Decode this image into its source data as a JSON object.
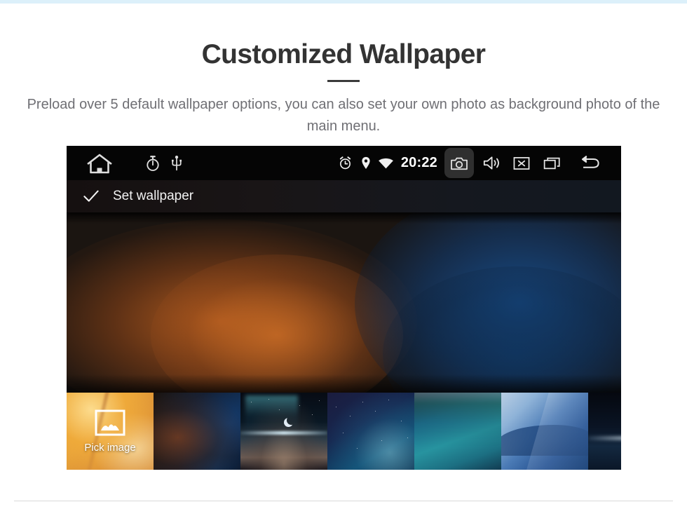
{
  "header": {
    "title": "Customized Wallpaper",
    "subtitle": "Preload over 5 default wallpaper options, you can also set your own photo as background photo of the main menu.",
    "accent_color": "#dcf0fa",
    "title_color": "#333333",
    "subtitle_color": "#6f6f74"
  },
  "device": {
    "statusbar": {
      "background": "#050505",
      "clock": "20:22",
      "left_icons": [
        {
          "name": "home-icon",
          "label": "Home"
        },
        {
          "name": "timer-icon",
          "label": "Timer"
        },
        {
          "name": "usb-icon",
          "label": "USB"
        }
      ],
      "right_icons": [
        {
          "name": "alarm-icon",
          "label": "Alarm"
        },
        {
          "name": "location-pin-icon",
          "label": "Location"
        },
        {
          "name": "wifi-icon",
          "label": "Wi-Fi"
        },
        {
          "name": "camera-icon",
          "label": "Screenshot",
          "highlighted": true
        },
        {
          "name": "volume-icon",
          "label": "Volume"
        },
        {
          "name": "close-icon",
          "label": "Close"
        },
        {
          "name": "recents-icon",
          "label": "Recent apps"
        },
        {
          "name": "back-icon",
          "label": "Back"
        }
      ]
    },
    "actionbar": {
      "confirm_icon": "check-icon",
      "label": "Set wallpaper"
    },
    "preview": {
      "name": "wallpaper-preview",
      "description": "Blurred gradient wallpaper with warm orange glow at left and deep blue glow at right",
      "warm_color": "#ba6020",
      "cool_color": "#184e8c"
    },
    "thumbnails": [
      {
        "name": "pick-image-tile",
        "label": "Pick image",
        "icon": "picture-icon",
        "selected": true
      },
      {
        "name": "wallpaper-thumb-2",
        "label": ""
      },
      {
        "name": "wallpaper-thumb-3",
        "label": ""
      },
      {
        "name": "wallpaper-thumb-4",
        "label": ""
      },
      {
        "name": "wallpaper-thumb-5",
        "label": ""
      },
      {
        "name": "wallpaper-thumb-6",
        "label": ""
      },
      {
        "name": "wallpaper-thumb-7",
        "label": ""
      }
    ]
  }
}
